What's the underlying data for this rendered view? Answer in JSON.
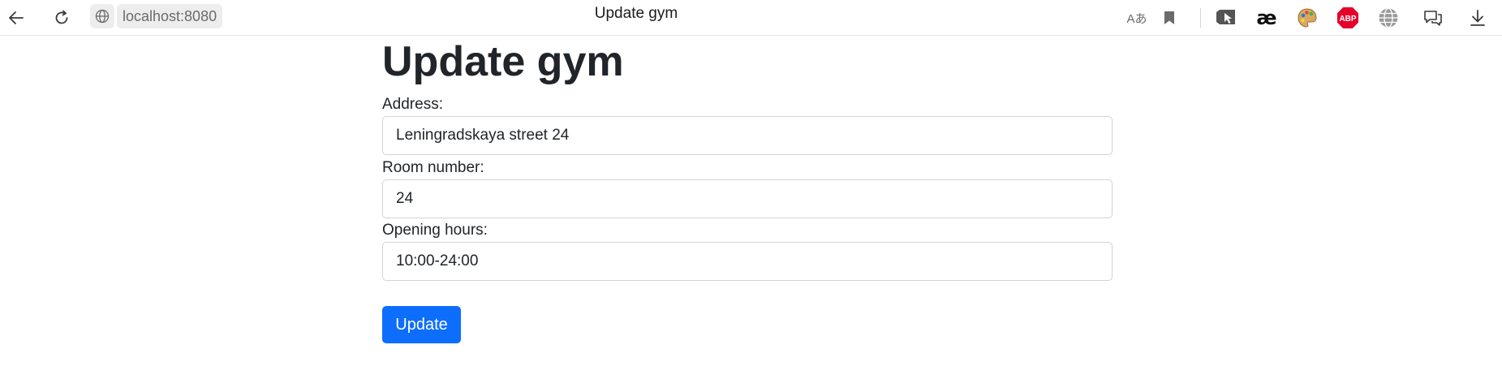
{
  "browser": {
    "url": "localhost:8080",
    "tab_title": "Update gym",
    "icons": {
      "back": "back-arrow-icon",
      "reload": "reload-icon",
      "site_info": "globe-icon",
      "read_aloud": "read-aloud-icon",
      "favorite": "bookmark-icon",
      "extension_cursor": "cursor-extension-icon",
      "extension_ae": "ae-extension-icon",
      "extension_palette": "palette-extension-icon",
      "extension_abp": "adblock-plus-icon",
      "extension_globe": "globe-extension-icon",
      "feedback": "feedback-icon",
      "downloads": "download-icon"
    },
    "read_aloud_label": "Aあ",
    "ae_label": "æ",
    "abp_label": "ABP"
  },
  "page": {
    "title": "Update gym",
    "form": {
      "address_label": "Address:",
      "address_value": "Leningradskaya street 24",
      "room_label": "Room number:",
      "room_value": "24",
      "hours_label": "Opening hours:",
      "hours_value": "10:00-24:00",
      "submit_label": "Update"
    }
  },
  "colors": {
    "primary": "#0d6efd",
    "text": "#212529",
    "input_border": "#ced4da",
    "abp_red": "#e4002b"
  }
}
